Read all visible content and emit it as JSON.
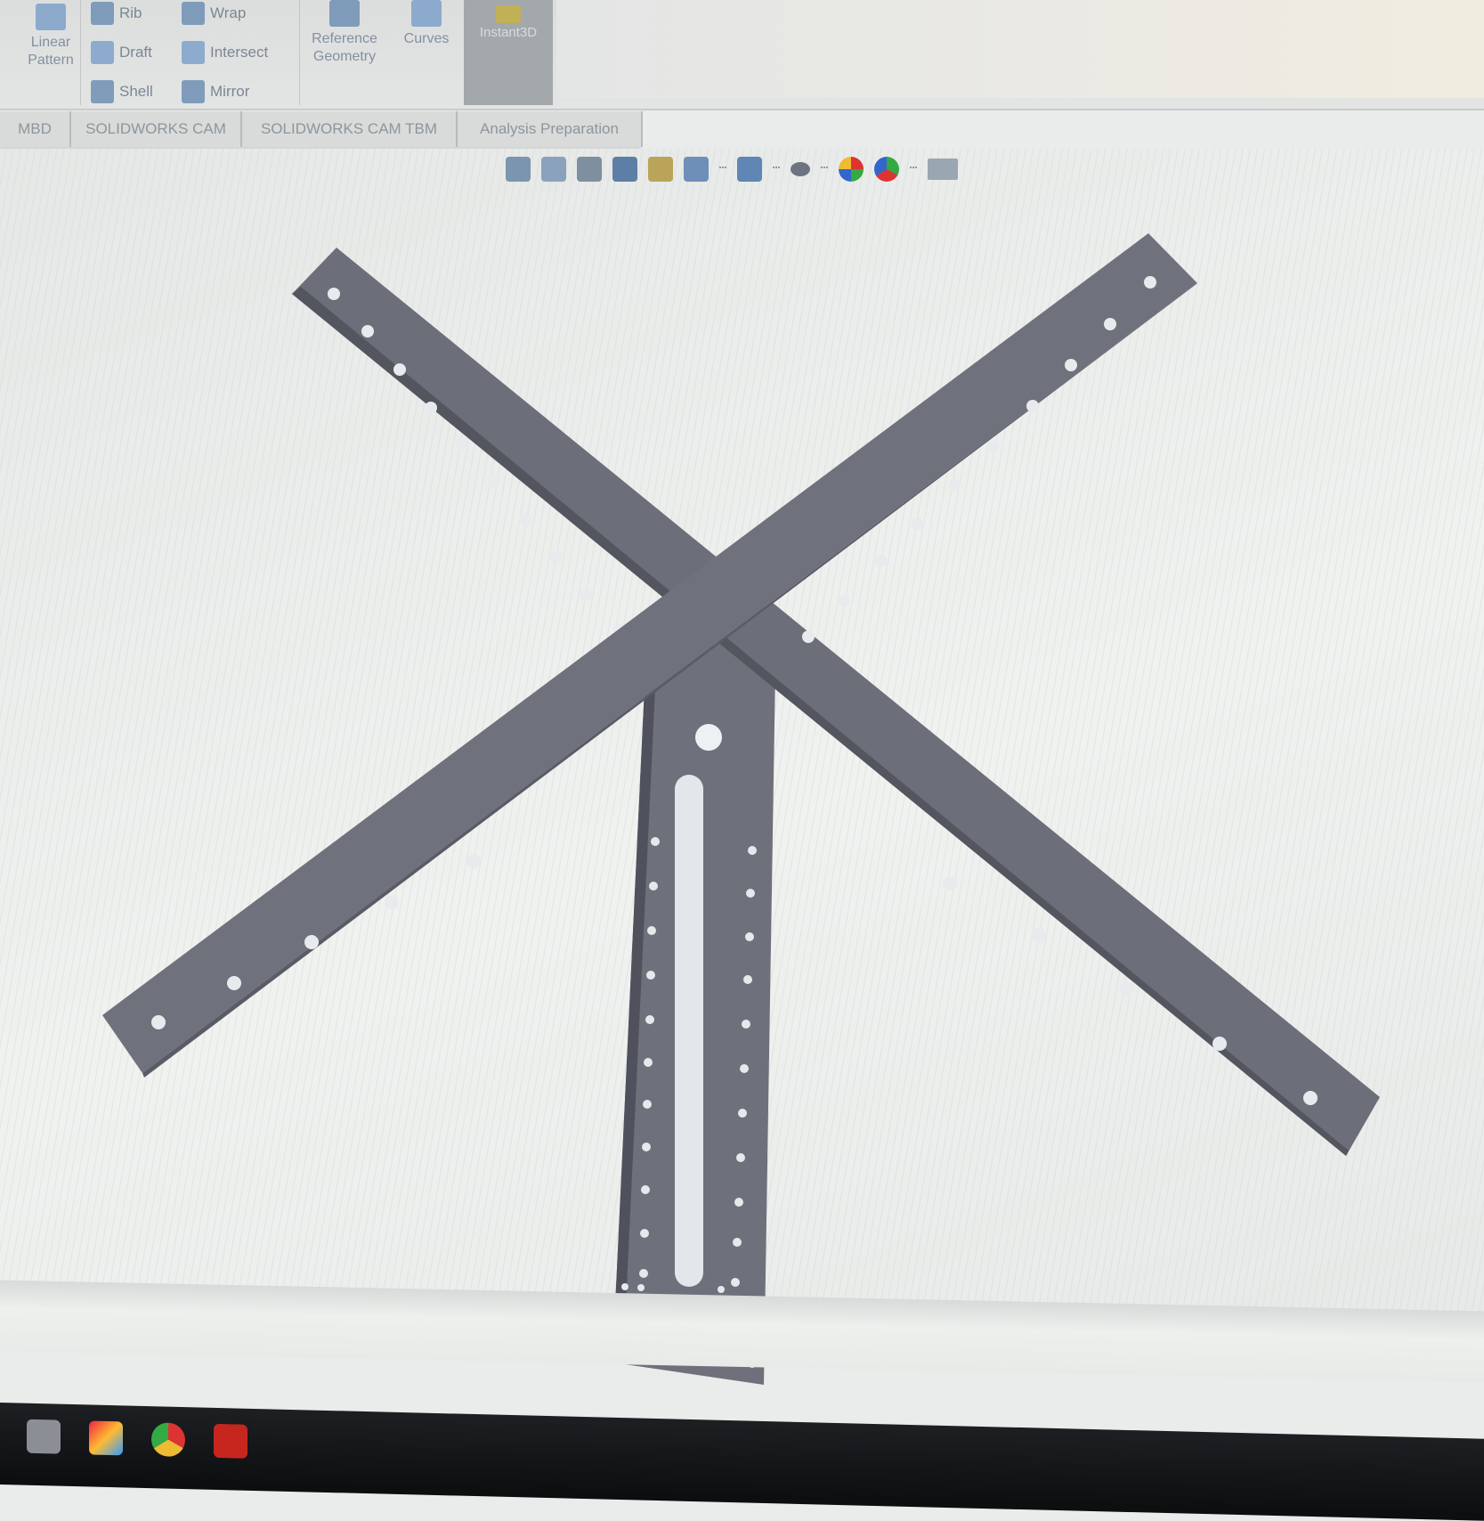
{
  "ribbon": {
    "items": [
      {
        "label": "Rib"
      },
      {
        "label": "Draft"
      },
      {
        "label": "Shell"
      },
      {
        "label": "Wrap"
      },
      {
        "label": "Intersect"
      },
      {
        "label": "Mirror"
      }
    ],
    "linear_pattern_label": "Linear Pattern",
    "reference_geometry_label": "Reference Geometry",
    "curves_label": "Curves",
    "instant3d_label": "Instant3D"
  },
  "tabs": [
    {
      "label": "MBD"
    },
    {
      "label": "SOLIDWORKS CAM"
    },
    {
      "label": "SOLIDWORKS CAM TBM"
    },
    {
      "label": "Analysis Preparation"
    }
  ],
  "view_toolbar": {
    "icons": [
      "zoom-to-fit-icon",
      "zoom-to-area-icon",
      "previous-view-icon",
      "section-view-icon",
      "dynamic-annotation-icon",
      "view-orientation-icon",
      "display-style-icon",
      "hide-show-icon",
      "edit-appearance-icon",
      "apply-scene-icon",
      "view-settings-icon"
    ]
  },
  "colors": {
    "part": "#6c6f7a",
    "part_dark": "#5b5e69",
    "hole": "#e8ebee"
  },
  "taskbar": {
    "apps": [
      "file-explorer-icon",
      "photos-icon",
      "chrome-icon",
      "solidworks-icon"
    ]
  }
}
